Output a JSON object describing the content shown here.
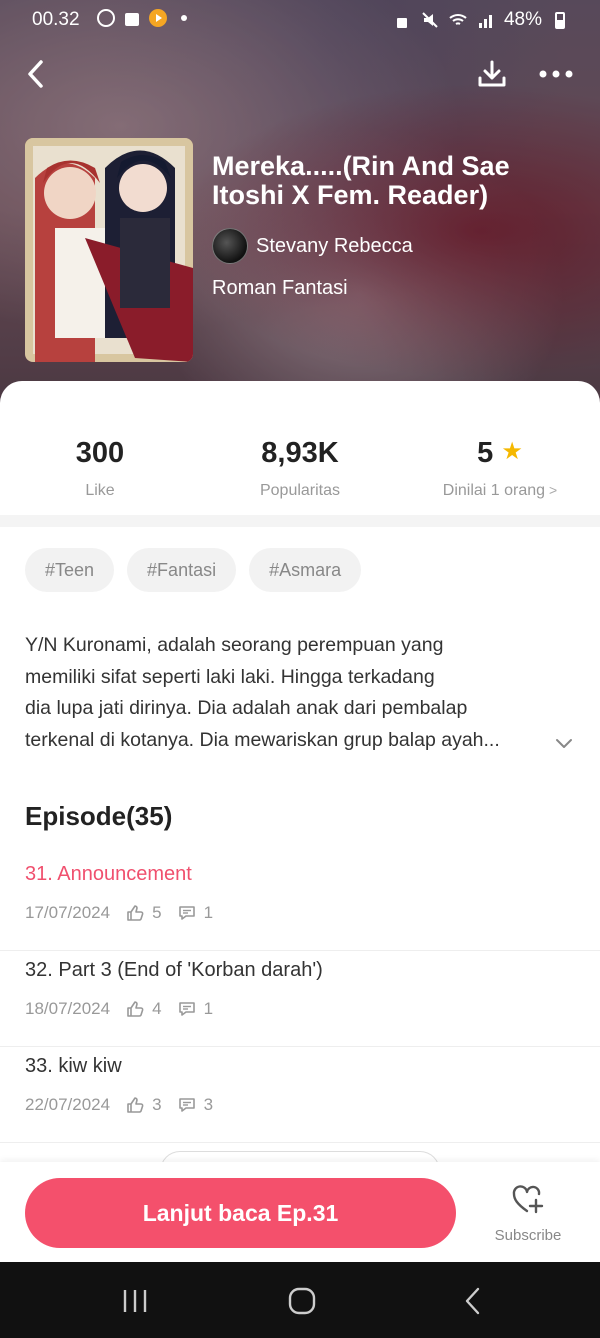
{
  "status_bar": {
    "time": "00.32",
    "battery": "48%"
  },
  "book": {
    "title": "Mereka.....(Rin And Sae Itoshi X Fem. Reader)",
    "author": "Stevany Rebecca",
    "genre": "Roman Fantasi"
  },
  "stats": {
    "likes": {
      "value": "300",
      "label": "Like"
    },
    "popularity": {
      "value": "8,93K",
      "label": "Popularitas"
    },
    "rating": {
      "value": "5",
      "label": "Dinilai 1 orang"
    }
  },
  "tags": [
    "#Teen",
    "#Fantasi",
    "#Asmara"
  ],
  "synopsis": {
    "lines": [
      "Y/N Kuronami, adalah seorang perempuan yang",
      "memiliki sifat seperti laki laki. Hingga terkadang",
      "dia lupa jati dirinya. Dia adalah anak dari pembalap",
      "terkenal di kotanya. Dia mewariskan grup balap ayah..."
    ]
  },
  "episodes": {
    "header": "Episode(35)",
    "items": [
      {
        "title": "31. Announcement",
        "date": "17/07/2024",
        "likes": "5",
        "comments": "1",
        "active": true
      },
      {
        "title": "32. Part 3 (End of 'Korban darah')",
        "date": "18/07/2024",
        "likes": "4",
        "comments": "1",
        "active": false
      },
      {
        "title": "33. kiw kiw",
        "date": "22/07/2024",
        "likes": "3",
        "comments": "3",
        "active": false
      }
    ]
  },
  "actions": {
    "continue_label": "Lanjut baca Ep.31",
    "subscribe_label": "Subscribe"
  },
  "colors": {
    "accent": "#f4506c",
    "active_episode": "#f0506e",
    "star": "#f5b800"
  },
  "icons": [
    "back-icon",
    "download-icon",
    "more-icon",
    "star-icon",
    "chevron-right-icon",
    "chevron-down-icon",
    "thumb-up-icon",
    "comment-icon",
    "heart-plus-icon"
  ]
}
